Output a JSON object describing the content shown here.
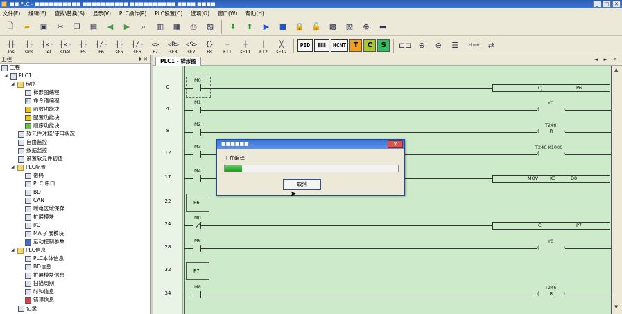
{
  "window": {
    "title": "■■ PLC – ■■■■■■■■■■ ■■■■■■■■■■ ■■■■■■■■■■ ■■■■ ■■■■"
  },
  "menu": [
    "文件(F)",
    "编辑(E)",
    "查找\\替换(S)",
    "显示(V)",
    "PLC操作(P)",
    "PLC设置(C)",
    "选项(O)",
    "窗口(W)",
    "帮助(H)"
  ],
  "toolbar2": [
    {
      "sym": "┤├",
      "label": "Ins"
    },
    {
      "sym": "┤├",
      "label": "sIns"
    },
    {
      "sym": "┤×├",
      "label": "Del"
    },
    {
      "sym": "┤×├",
      "label": "sDel"
    },
    {
      "sym": "┤├",
      "label": "F5"
    },
    {
      "sym": "┤/├",
      "label": "F6"
    },
    {
      "sym": "┤├",
      "label": "sF5"
    },
    {
      "sym": "┤/├",
      "label": "sF6"
    },
    {
      "sym": "<>",
      "label": "F7"
    },
    {
      "sym": "<R>",
      "label": "sF8"
    },
    {
      "sym": "<S>",
      "label": "sF7"
    },
    {
      "sym": "{}",
      "label": "F8"
    },
    {
      "sym": "─",
      "label": "F11"
    },
    {
      "sym": "┼",
      "label": "sF11"
    },
    {
      "sym": "│",
      "label": "F12"
    },
    {
      "sym": "╳",
      "label": "sF12"
    }
  ],
  "toolbar2_boxes": [
    "PID",
    "ⅡⅡⅡ",
    "HCNT"
  ],
  "toolbar2_colors": [
    {
      "letter": "T",
      "color": "#f0a020"
    },
    {
      "letter": "C",
      "color": "#a8c830"
    },
    {
      "letter": "S",
      "color": "#30c060"
    }
  ],
  "ld_label": "Ld m0",
  "panel": {
    "title": "工程",
    "pin": "♦ ✕"
  },
  "tree": {
    "project": "工程",
    "plc": "PLC1",
    "program": "程序",
    "ladder": "梯形图编程",
    "instruction": "命令语编程",
    "func_block": "函数功能块",
    "config_block": "配置功能块",
    "seq_block": "顺序功能块",
    "comment": "软元件注释/使用状况",
    "free_monitor": "自由监控",
    "data_monitor": "数据监控",
    "init_value": "设置软元件初值",
    "plc_config": "PLC配置",
    "password": "密码",
    "serial": "PLC 串口",
    "bd": "BD",
    "can": "CAN",
    "power_save": "断电区域保存",
    "ext_module": "扩展模块",
    "io": "I/O",
    "ma_ext": "MA 扩展模块",
    "motion": "运动控制参数",
    "plc_info": "PLC信息",
    "plc_body": "PLC本体信息",
    "bd_info": "BD信息",
    "ext_info": "扩展模块信息",
    "scan": "扫描周期",
    "clock": "时钟信息",
    "error": "错误信息",
    "record": "记录"
  },
  "document": {
    "tab": "PLC1 - 梯形图",
    "nav": "◄ ► ✕"
  },
  "ladder": {
    "rungs": [
      {
        "num": "0",
        "contact": "M0",
        "instr": [
          "CJ",
          "P6"
        ]
      },
      {
        "num": "4",
        "contact": "M1",
        "coil": "Y0"
      },
      {
        "num": "8",
        "contact": "M2",
        "coil_top": "T246",
        "coil": "R"
      },
      {
        "num": "12",
        "contact": "M3",
        "coil_top": "T246    K1000"
      },
      {
        "num": "17",
        "contact": "M4",
        "instr": [
          "MOV",
          "K3",
          "D0"
        ]
      },
      {
        "num": "22",
        "pointer": "P6"
      },
      {
        "num": "24",
        "contact": "M0",
        "instr": [
          "CJ",
          "P7"
        ]
      },
      {
        "num": "28",
        "contact": "M6",
        "coil": "Y0"
      },
      {
        "num": "32",
        "pointer": "P7"
      },
      {
        "num": "34",
        "contact": "M8",
        "coil_top": "T246",
        "coil": "R"
      }
    ]
  },
  "dialog": {
    "title": "■■■■■■...",
    "close": "✕",
    "message": "正在编译",
    "progress": 0.1,
    "button": "取消"
  }
}
